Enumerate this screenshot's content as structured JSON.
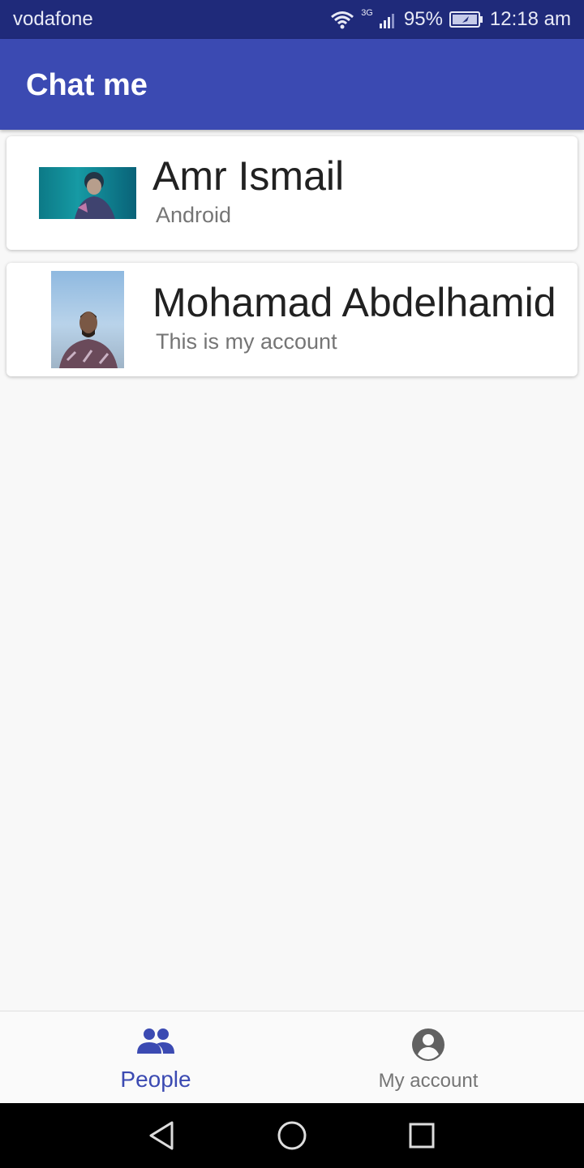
{
  "status_bar": {
    "carrier": "vodafone",
    "network": "3G",
    "battery": "95%",
    "time": "12:18 am"
  },
  "app_bar": {
    "title": "Chat me"
  },
  "people": [
    {
      "name": "Amr Ismail",
      "status": "Android"
    },
    {
      "name": "Mohamad Abdelhamid",
      "status": "This is my account"
    }
  ],
  "bottom_nav": {
    "items": [
      {
        "label": "People",
        "icon": "people-icon",
        "active": true
      },
      {
        "label": "My account",
        "icon": "account-circle-icon",
        "active": false
      }
    ]
  },
  "colors": {
    "primary": "#3b4ab2",
    "status_bar": "#1f2a7a",
    "inactive": "#757575"
  }
}
